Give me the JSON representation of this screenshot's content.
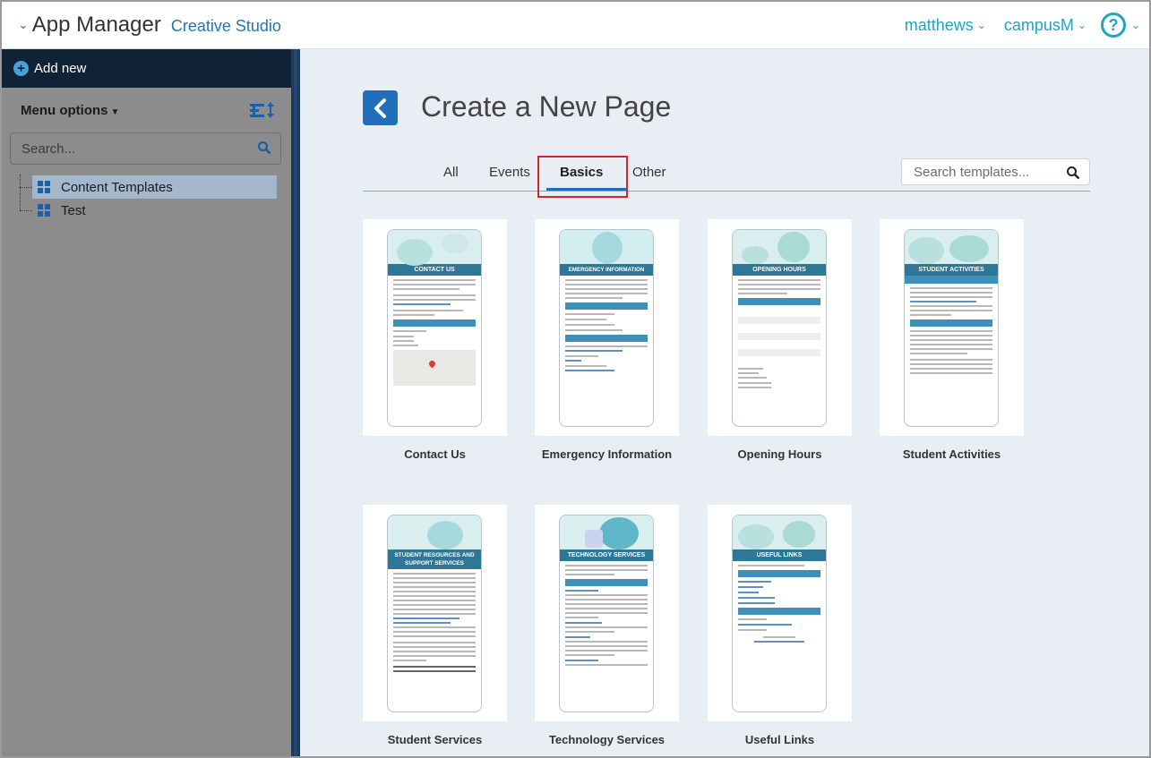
{
  "header": {
    "app_name": "App Manager",
    "app_subtitle": "Creative Studio",
    "user_menu": "matthews",
    "campus_menu": "campusM",
    "help_label": "?"
  },
  "sidebar": {
    "add_new": "Add new",
    "menu_options": "Menu options",
    "search_placeholder": "Search...",
    "tree": [
      {
        "label": "Content Templates",
        "selected": true
      },
      {
        "label": "Test",
        "selected": false
      }
    ]
  },
  "main": {
    "title": "Create a New Page",
    "tabs": [
      {
        "label": "All"
      },
      {
        "label": "Events"
      },
      {
        "label": "Basics"
      },
      {
        "label": "Other"
      }
    ],
    "active_tab": "Basics",
    "search_placeholder": "Search templates...",
    "templates": [
      {
        "name": "Contact Us",
        "banner": "CONTACT US"
      },
      {
        "name": "Emergency Information",
        "banner": "EMERGENCY INFORMATION"
      },
      {
        "name": "Opening Hours",
        "banner": "OPENING HOURS"
      },
      {
        "name": "Student Activities",
        "banner": "STUDENT ACTIVITIES"
      },
      {
        "name": "Student Services",
        "banner": "STUDENT RESOURCES AND SUPPORT SERVICES"
      },
      {
        "name": "Technology Services",
        "banner": "TECHNOLOGY SERVICES"
      },
      {
        "name": "Useful Links",
        "banner": "USEFUL LINKS"
      }
    ]
  },
  "colors": {
    "accent": "#1f6fba",
    "highlight": "#d32828",
    "sidebar_bg": "#8c8c8c",
    "banner": "#2f7797"
  }
}
